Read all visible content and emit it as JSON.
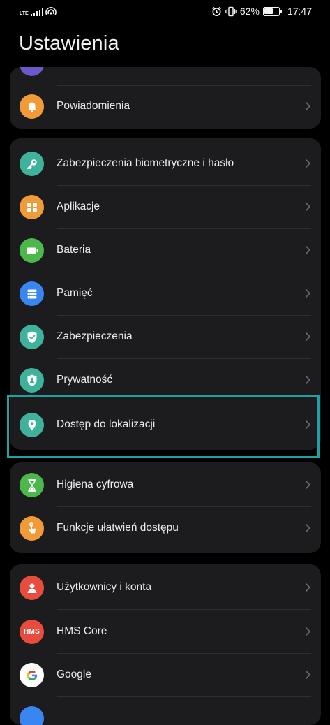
{
  "status_bar": {
    "network": "LTE",
    "battery_percent": "62%",
    "battery_level": 0.62,
    "time": "17:47",
    "icons": [
      "signal-bars-icon",
      "wifi-hotspot-icon",
      "alarm-icon",
      "vibrate-icon",
      "battery-icon"
    ]
  },
  "header": {
    "title": "Ustawienia"
  },
  "groups": [
    {
      "items": [
        {
          "label": "",
          "icon": "partial-icon",
          "color": "#6d58c9"
        },
        {
          "label": "Powiadomienia",
          "icon": "bell-icon",
          "color": "#f19a38"
        }
      ]
    },
    {
      "items": [
        {
          "label": "Zabezpieczenia biometryczne i hasło",
          "icon": "key-icon",
          "color": "#3fb29c"
        },
        {
          "label": "Aplikacje",
          "icon": "apps-grid-icon",
          "color": "#f19a38"
        },
        {
          "label": "Bateria",
          "icon": "battery-icon",
          "color": "#4cb84c"
        },
        {
          "label": "Pamięć",
          "icon": "storage-icon",
          "color": "#3a86f0"
        },
        {
          "label": "Zabezpieczenia",
          "icon": "shield-check-icon",
          "color": "#3fb29c"
        },
        {
          "label": "Prywatność",
          "icon": "privacy-shield-icon",
          "color": "#3fb29c"
        },
        {
          "label": "Dostęp do lokalizacji",
          "icon": "location-pin-icon",
          "color": "#3fb29c",
          "highlighted": true
        }
      ]
    },
    {
      "items": [
        {
          "label": "Higiena cyfrowa",
          "icon": "hourglass-icon",
          "color": "#4cb84c"
        },
        {
          "label": "Funkcje ułatwień dostępu",
          "icon": "accessibility-hand-icon",
          "color": "#f19a38"
        }
      ]
    },
    {
      "items": [
        {
          "label": "Użytkownicy i konta",
          "icon": "user-icon",
          "color": "#e74c3c"
        },
        {
          "label": "HMS Core",
          "icon": "hms-icon",
          "color": "#e74c3c",
          "icon_text": "HMS"
        },
        {
          "label": "Google",
          "icon": "google-icon",
          "color": "#ffffff"
        },
        {
          "label": "",
          "icon": "partial-icon",
          "color": "#3a86f0"
        }
      ]
    }
  ]
}
